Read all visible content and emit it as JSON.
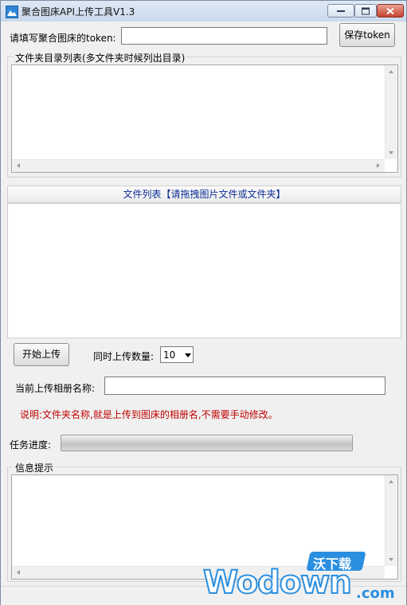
{
  "window": {
    "title": "聚合图床API上传工具V1.3"
  },
  "token_row": {
    "label": "请填写聚合图床的token:",
    "value": "",
    "save_button": "保存token"
  },
  "folder_group": {
    "title": "文件夹目录列表(多文件夹时候列出目录)"
  },
  "file_list": {
    "header": "文件列表【请拖拽图片文件或文件夹】"
  },
  "upload_controls": {
    "start_button": "开始上传",
    "concurrency_label": "同时上传数量:",
    "concurrency_value": "10"
  },
  "album": {
    "label": "当前上传相册名称:",
    "value": ""
  },
  "note": {
    "text": "说明:文件夹名称,就是上传到图床的相册名,不需要手动修改。",
    "color": "#c00000"
  },
  "progress": {
    "label": "任务进度:",
    "percent": 0
  },
  "info_group": {
    "title": "信息提示"
  },
  "watermark": {
    "cn": "沃下载",
    "brand": "Wodown",
    "tld": ".com"
  }
}
